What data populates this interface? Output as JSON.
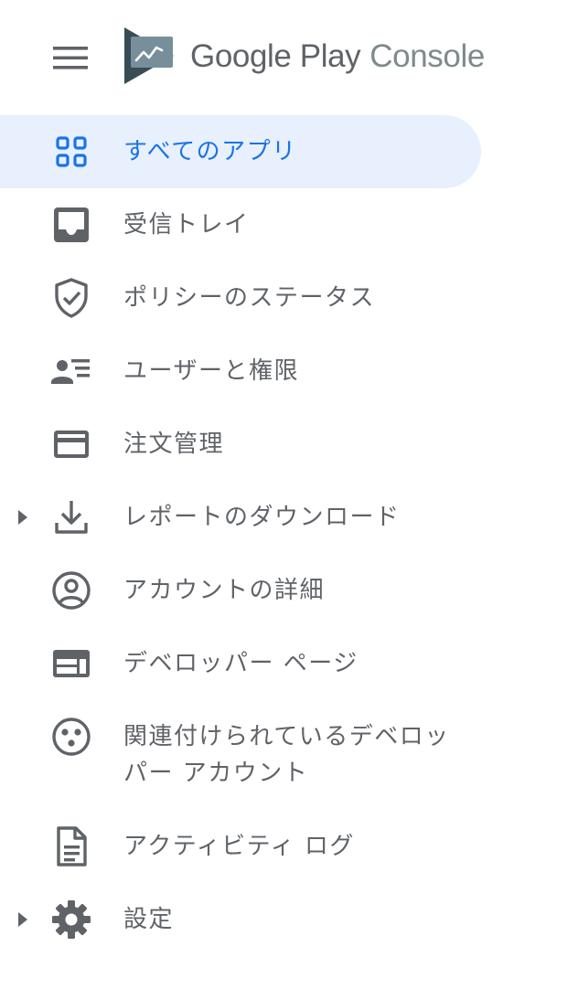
{
  "header": {
    "brand_google": "Google Play",
    "brand_console": "Console"
  },
  "colors": {
    "accent": "#1a73e8",
    "active_background": "#e8f0fe",
    "text": "#5f6368",
    "logo_dark": "#394c56",
    "logo_light": "#778f9b"
  },
  "nav": {
    "items": [
      {
        "label": "すべてのアプリ",
        "icon": "apps-grid-icon",
        "active": true
      },
      {
        "label": "受信トレイ",
        "icon": "inbox-icon"
      },
      {
        "label": "ポリシーのステータス",
        "icon": "shield-check-icon"
      },
      {
        "label": "ユーザーと権限",
        "icon": "user-list-icon"
      },
      {
        "label": "注文管理",
        "icon": "credit-card-icon"
      },
      {
        "label": "レポートのダウンロード",
        "icon": "download-icon",
        "expandable": true
      },
      {
        "label": "アカウントの詳細",
        "icon": "account-circle-icon"
      },
      {
        "label": "デベロッパー ページ",
        "icon": "web-page-icon"
      },
      {
        "label": "関連付けられているデベロッパー アカウント",
        "icon": "linked-accounts-icon"
      },
      {
        "label": "アクティビティ ログ",
        "icon": "document-icon"
      },
      {
        "label": "設定",
        "icon": "gear-icon",
        "expandable": true
      }
    ]
  }
}
